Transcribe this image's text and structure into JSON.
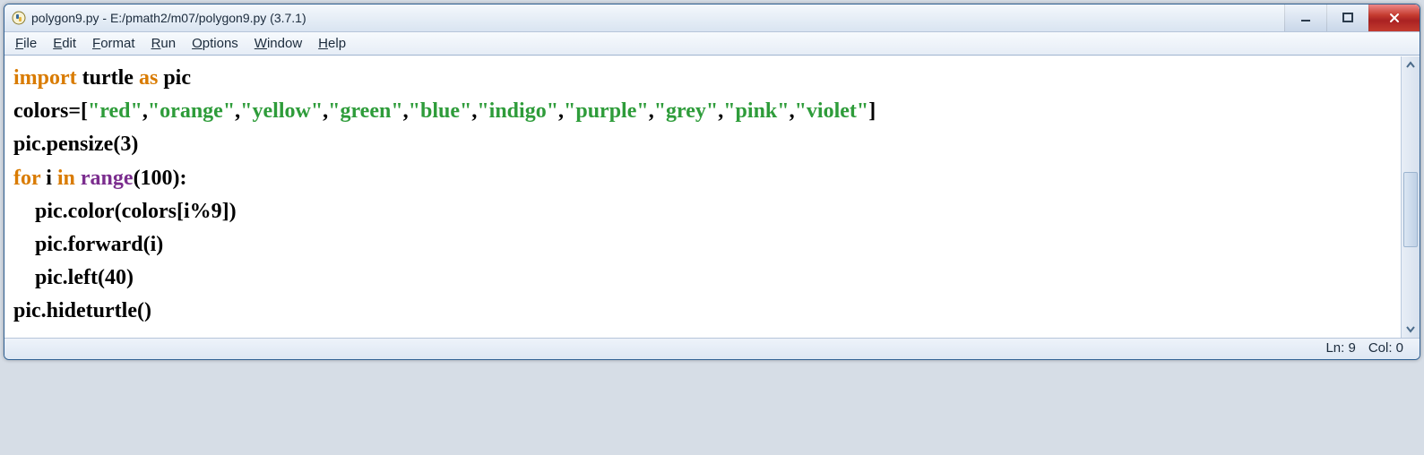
{
  "title": "polygon9.py - E:/pmath2/m07/polygon9.py (3.7.1)",
  "menu": {
    "file": {
      "u": "F",
      "rest": "ile"
    },
    "edit": {
      "u": "E",
      "rest": "dit"
    },
    "format": {
      "u": "F",
      "rest": "ormat"
    },
    "run": {
      "u": "R",
      "rest": "un"
    },
    "options": {
      "u": "O",
      "rest": "ptions"
    },
    "window": {
      "u": "W",
      "rest": "indow"
    },
    "help": {
      "u": "H",
      "rest": "elp"
    }
  },
  "code": {
    "l1": {
      "kw_import": "import",
      "sp1": " ",
      "turtle": "turtle",
      "sp2": " ",
      "kw_as": "as",
      "sp3": " ",
      "pic": "pic"
    },
    "l2": {
      "pre": "colors=[",
      "s0": "\"red\"",
      "c0": ",",
      "s1": "\"orange\"",
      "c1": ",",
      "s2": "\"yellow\"",
      "c2": ",",
      "s3": "\"green\"",
      "c3": ",",
      "s4": "\"blue\"",
      "c4": ",",
      "s5": "\"indigo\"",
      "c5": ",",
      "s6": "\"purple\"",
      "c6": ",",
      "s7": "\"grey\"",
      "c7": ",",
      "s8": "\"pink\"",
      "c8": ",",
      "s9": "\"violet\"",
      "post": "]"
    },
    "l3": "pic.pensize(3)",
    "l4": {
      "kw_for": "for",
      "sp1": " ",
      "i": "i",
      "sp2": " ",
      "kw_in": "in",
      "sp3": " ",
      "range": "range",
      "rest": "(100):"
    },
    "l5": "    pic.color(colors[i%9])",
    "l6": "    pic.forward(i)",
    "l7": "    pic.left(40)",
    "l8": "pic.hideturtle()"
  },
  "status": {
    "ln": "Ln: 9",
    "col": "Col: 0"
  }
}
